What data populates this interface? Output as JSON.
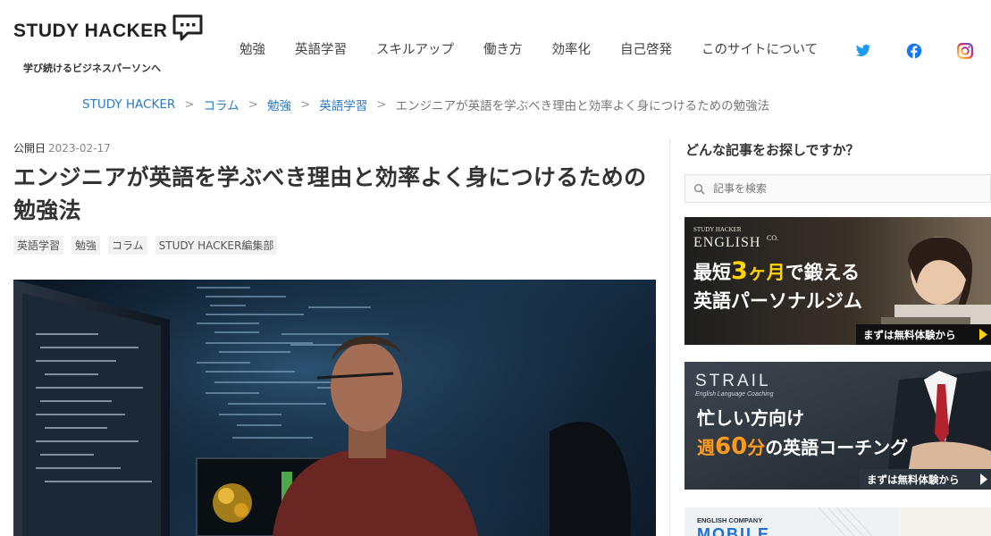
{
  "header": {
    "logo_text": "STUDY HACKER",
    "tagline": "学び続けるビジネスパーソンへ",
    "nav": [
      "勉強",
      "英語学習",
      "スキルアップ",
      "働き方",
      "効率化",
      "自己啓発",
      "このサイトについて"
    ],
    "social_icons": [
      "twitter-icon",
      "facebook-icon",
      "instagram-icon"
    ]
  },
  "breadcrumb": {
    "items": [
      "STUDY HACKER",
      "コラム",
      "勉強",
      "英語学習"
    ],
    "separator": ">",
    "current": "エンジニアが英語を学ぶべき理由と効率よく身につけるための勉強法"
  },
  "article": {
    "published_label": "公開日",
    "published_date": "2023-02-17",
    "title": "エンジニアが英語を学ぶべき理由と効率よく身につけるための勉強法",
    "tags": [
      "英語学習",
      "勉強",
      "コラム",
      "STUDY HACKER編集部"
    ]
  },
  "sidebar": {
    "heading": "どんな記事をお探しですか？",
    "search_placeholder": "記事を検索",
    "banners": [
      {
        "brand_small": "STUDY HACKER",
        "brand": "ENGLISH",
        "brand_sup": "CO.",
        "line1_a": "最短",
        "line1_b": "3",
        "line1_c": "ヶ月",
        "line1_d": "で鍛える",
        "line2": "英語パーソナルジム",
        "cta": "まずは無料体験から"
      },
      {
        "brand": "STRAIL",
        "brand_sub": "English Language Coaching",
        "line1": "忙しい方向け",
        "line2_a": "週",
        "line2_b": "60",
        "line2_c": "分",
        "line2_d": "の英語コーチング",
        "cta": "まずは無料体験から"
      },
      {
        "brand_small": "ENGLISH COMPANY",
        "brand": "MOBILE"
      }
    ]
  },
  "colors": {
    "link": "#2b79c2",
    "twitter": "#1d9bf0",
    "facebook": "#1877f2",
    "instagram": "#d62976",
    "banner_accent": "#ffd400",
    "banner_orange": "#ff9a1f"
  }
}
